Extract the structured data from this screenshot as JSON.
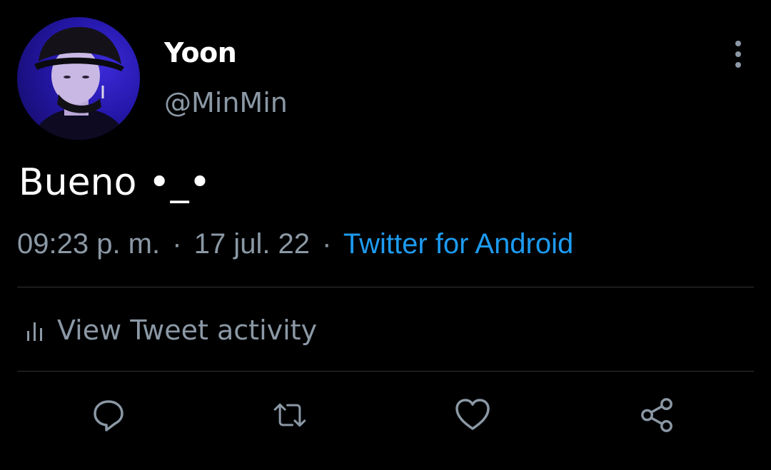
{
  "tweet": {
    "author": {
      "display_name": "Yoon",
      "handle": "@MinMin"
    },
    "text": "Bueno •_•",
    "time": "09:23 p. m.",
    "separator": "·",
    "date": "17 jul. 22",
    "source": "Twitter for Android",
    "activity_label": "View Tweet activity"
  },
  "actions": [
    {
      "name": "reply",
      "icon": "reply-icon"
    },
    {
      "name": "retweet",
      "icon": "retweet-icon"
    },
    {
      "name": "like",
      "icon": "heart-icon"
    },
    {
      "name": "share",
      "icon": "share-icon"
    }
  ],
  "colors": {
    "background": "#000000",
    "primary_text": "#ffffff",
    "secondary_text": "#8b98a5",
    "link": "#1d9bf0",
    "divider": "#2f3336"
  }
}
